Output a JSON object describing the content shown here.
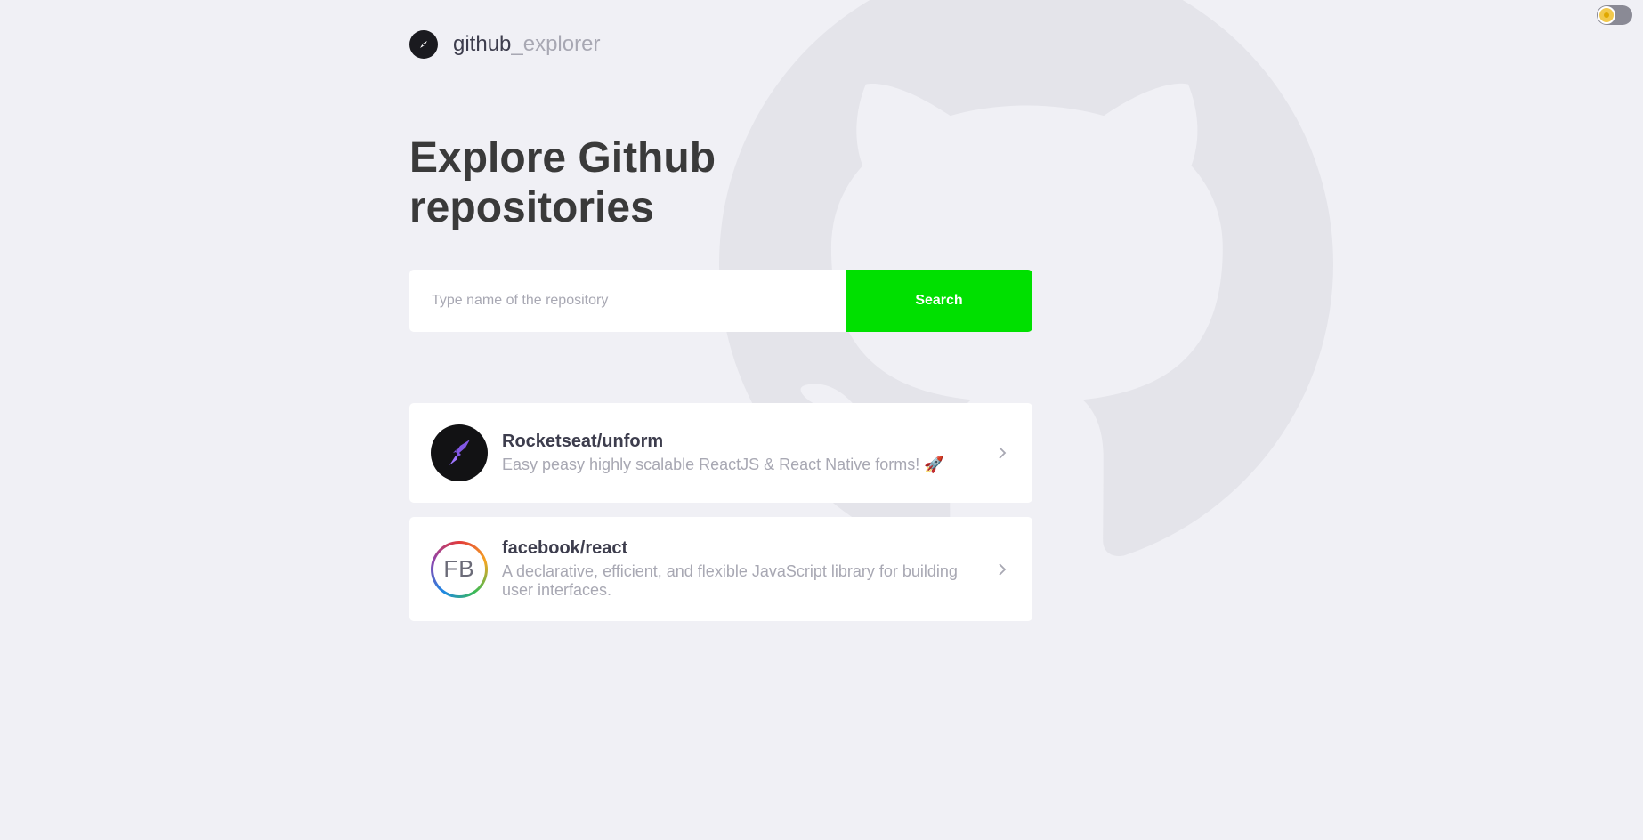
{
  "app": {
    "brand_main": "github",
    "brand_accent": "_explorer",
    "title_line1": "Explore Github",
    "title_line2": "repositories"
  },
  "search": {
    "placeholder": "Type name of the repository",
    "value": "",
    "button_label": "Search"
  },
  "repositories": [
    {
      "name": "Rocketseat/unform",
      "description": "Easy peasy highly scalable ReactJS & React Native forms! 🚀",
      "avatar": "rocket-logo"
    },
    {
      "name": "facebook/react",
      "description": "A declarative, efficient, and flexible JavaScript library for building user interfaces.",
      "avatar_text": "FB"
    }
  ],
  "colors": {
    "background": "#f0f0f5",
    "accent_button": "#00e000",
    "title": "#3a3a3a",
    "muted": "#a8a8b3"
  },
  "icons": {
    "header": "compass-icon",
    "background": "github-octocat-icon",
    "theme": "sun-icon",
    "row_action": "chevron-right-icon"
  }
}
